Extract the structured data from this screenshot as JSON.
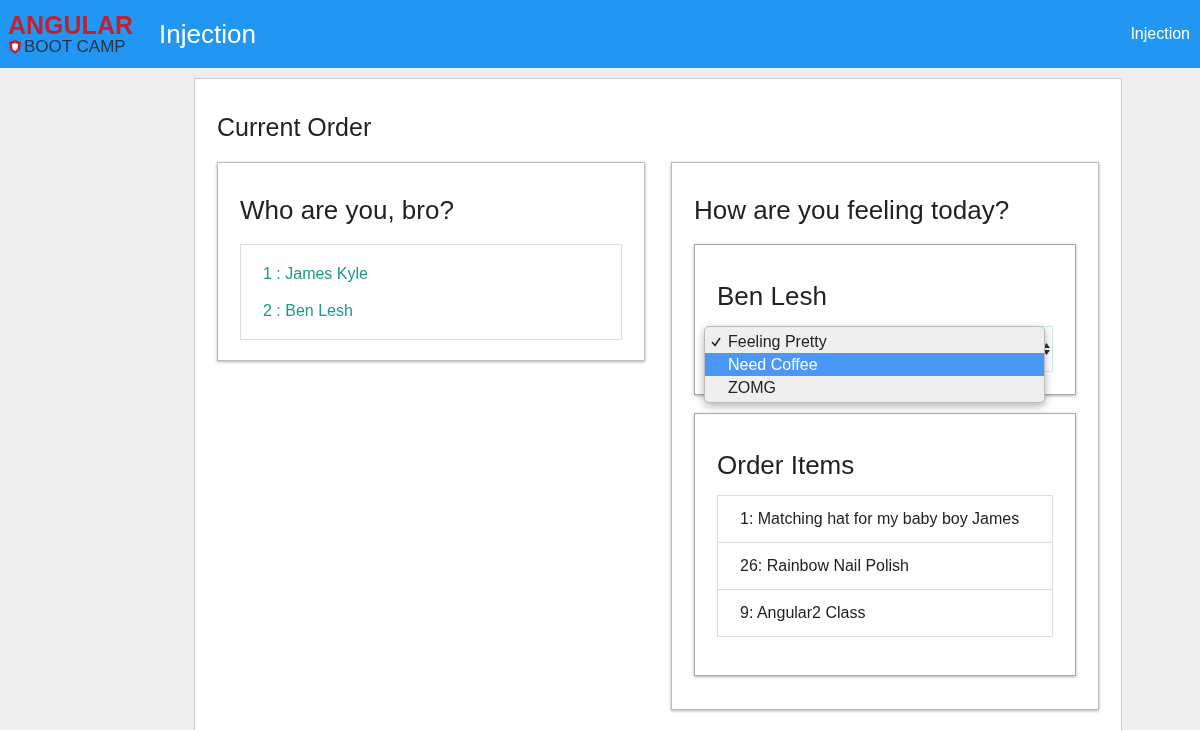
{
  "header": {
    "logo_top": "ANGULAR",
    "logo_bottom": "BOOT CAMP",
    "title": "Injection",
    "nav_link": "Injection"
  },
  "order": {
    "title": "Current Order",
    "people": {
      "title": "Who are you, bro?",
      "items": [
        {
          "label": "1 : James Kyle"
        },
        {
          "label": "2 : Ben Lesh"
        }
      ]
    },
    "feeling": {
      "title": "How are you feeling today?",
      "person": "Ben Lesh",
      "options": [
        {
          "label": "Feeling Pretty",
          "checked": true,
          "highlighted": false
        },
        {
          "label": "Need Coffee",
          "checked": false,
          "highlighted": true
        },
        {
          "label": "ZOMG",
          "checked": false,
          "highlighted": false
        }
      ]
    },
    "items": {
      "title": "Order Items",
      "rows": [
        {
          "label": "1: Matching hat for my baby boy James"
        },
        {
          "label": "26: Rainbow Nail Polish"
        },
        {
          "label": "9: Angular2 Class"
        }
      ]
    }
  }
}
